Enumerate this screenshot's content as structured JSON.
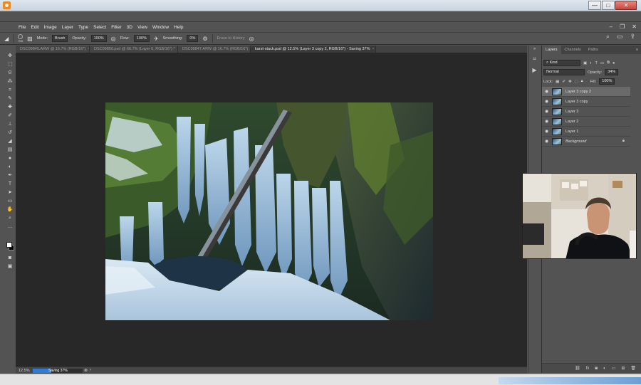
{
  "window": {
    "controls": {
      "minimize": "—",
      "maximize": "□",
      "close": "✕"
    }
  },
  "app": {
    "badge": "Ps"
  },
  "menu": [
    "File",
    "Edit",
    "Image",
    "Layer",
    "Type",
    "Select",
    "Filter",
    "3D",
    "View",
    "Window",
    "Help"
  ],
  "options": {
    "brush_size": "700",
    "mode_label": "Mode:",
    "mode_value": "Brush",
    "opacity_label": "Opacity:",
    "opacity_value": "100%",
    "flow_label": "Flow:",
    "flow_value": "100%",
    "smoothing_label": "Smoothing:",
    "smoothing_value": "0%",
    "erase_history_label": "Erase to History"
  },
  "tabs": [
    {
      "label": "DSC09845.ARW @ 16.7% (RGB/16*)",
      "active": false
    },
    {
      "label": "DSC09850.psd @ 66.7% (Layer 6, RGB/16*) *",
      "active": false
    },
    {
      "label": "DSC09847.ARW @ 16.7% (RGB/16*)",
      "active": false
    },
    {
      "label": "karst-stack.psd @ 12.5% (Layer 3 copy 2, RGB/16*) - Saving 37%",
      "active": true
    }
  ],
  "tools": [
    "move-icon",
    "marquee-icon",
    "lasso-icon",
    "magic-wand-icon",
    "crop-icon",
    "eyedropper-icon",
    "healing-icon",
    "brush-icon",
    "stamp-icon",
    "history-brush-icon",
    "eraser-icon",
    "gradient-icon",
    "blur-icon",
    "dodge-icon",
    "pen-icon",
    "type-icon",
    "path-select-icon",
    "shape-icon",
    "hand-icon",
    "zoom-icon",
    "more-icon"
  ],
  "status": {
    "zoom": "12.5%",
    "progress_text": "Saving 37%",
    "progress": 0.37
  },
  "panel": {
    "tabs": [
      "Layers",
      "Channels",
      "Paths"
    ],
    "active_tab": "Layers",
    "filter_kind": "Kind",
    "blend_mode": "Normal",
    "opacity_label": "Opacity:",
    "opacity_value": "34%",
    "lock_label": "Lock:",
    "fill_label": "Fill:",
    "fill_value": "100%",
    "layers": [
      {
        "name": "Layer 3 copy 2",
        "selected": true,
        "italic": false,
        "locked": false
      },
      {
        "name": "Layer 3 copy",
        "selected": false,
        "italic": false,
        "locked": false
      },
      {
        "name": "Layer 3",
        "selected": false,
        "italic": false,
        "locked": false
      },
      {
        "name": "Layer 2",
        "selected": false,
        "italic": false,
        "locked": false
      },
      {
        "name": "Layer 1",
        "selected": false,
        "italic": false,
        "locked": false
      },
      {
        "name": "Background",
        "selected": false,
        "italic": true,
        "locked": true
      }
    ],
    "footer_icons": [
      "link-icon",
      "fx-icon",
      "mask-icon",
      "adjustment-icon",
      "group-icon",
      "new-layer-icon",
      "trash-icon"
    ]
  },
  "colors": {
    "accent": "#31a8ff",
    "progress": "#2d7dd6",
    "panel_bg": "#535353",
    "canvas_bg": "#282828"
  }
}
